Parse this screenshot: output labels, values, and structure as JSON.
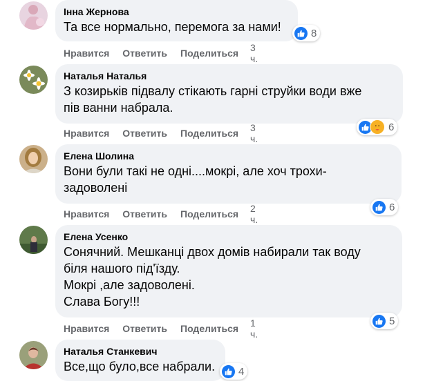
{
  "labels": {
    "like": "Нравится",
    "reply": "Ответить",
    "share": "Поделиться"
  },
  "comments": [
    {
      "author": "Інна Жернова",
      "lines": [
        "Та все нормально, перемога за нами!"
      ],
      "reaction_count": "8",
      "reactions": [
        "like-icon"
      ],
      "time": "3 ч."
    },
    {
      "author": "Наталья Наталья",
      "lines": [
        "З козирьків підвалу стікають гарні струйки води вже",
        "пів ванни набрала."
      ],
      "reaction_count": "6",
      "reactions": [
        "like-icon",
        "care-icon"
      ],
      "time": "3 ч."
    },
    {
      "author": "Елена Шолина",
      "lines": [
        "Вони були такі не одні....мокрі, але хоч трохи-",
        "задоволені"
      ],
      "reaction_count": "6",
      "reactions": [
        "like-icon"
      ],
      "time": "2 ч."
    },
    {
      "author": "Елена Усенко",
      "lines": [
        "Сонячний. Мешканці двох домів набирали так воду",
        "біля нашого під'їзду.",
        "Мокрі ,але задоволені.",
        "Слава Богу!!!"
      ],
      "reaction_count": "5",
      "reactions": [
        "like-icon"
      ],
      "time": "1 ч."
    },
    {
      "author": "Наталья Станкевич",
      "lines": [
        "Все,що було,все набрали."
      ],
      "reaction_count": "4",
      "reactions": [
        "like-icon"
      ],
      "time": ""
    }
  ],
  "colors": {
    "bubble": "#f0f2f5",
    "like_blue": "#1877f2",
    "meta_gray": "#65676b",
    "text": "#050505"
  }
}
